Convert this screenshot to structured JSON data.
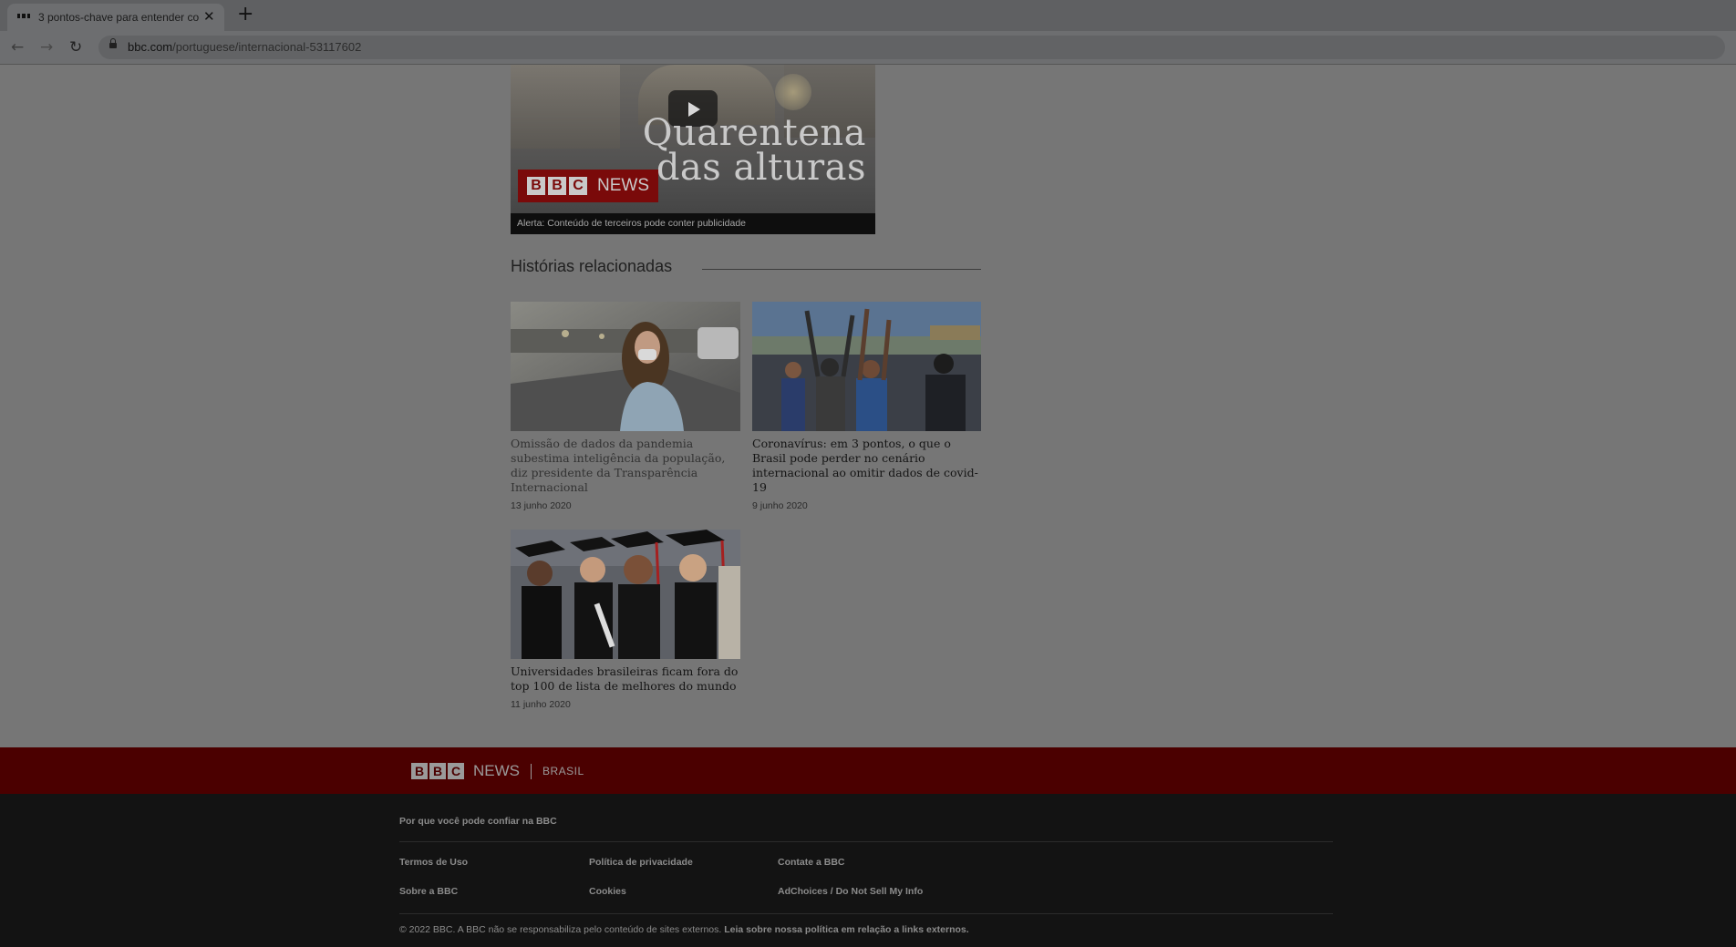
{
  "browser": {
    "tab_title": "3 pontos-chave para entender co",
    "url_host": "bbc.com",
    "url_path": "/portuguese/internacional-53117602"
  },
  "video": {
    "title_line1": "Quarentena",
    "title_line2": "das alturas",
    "logo_letters": [
      "B",
      "B",
      "C"
    ],
    "logo_word": "NEWS",
    "alert": "Alerta: Conteúdo de terceiros pode conter publicidade"
  },
  "related": {
    "heading": "Histórias relacionadas",
    "stories": [
      {
        "title": "Omissão de dados da pandemia subestima inteligência da população, diz presidente da Transparência Internacional",
        "date": "13 junho 2020"
      },
      {
        "title": "Coronavírus: em 3 pontos, o que o Brasil pode perder no cenário internacional ao omitir dados de covid-19",
        "date": "9 junho 2020"
      },
      {
        "title": "Universidades brasileiras ficam fora do top 100 de lista de melhores do mundo",
        "date": "11 junho 2020"
      }
    ]
  },
  "footer": {
    "logo_letters": [
      "B",
      "B",
      "C"
    ],
    "logo_word": "NEWS",
    "region": "BRASIL",
    "trust": "Por que você pode confiar na BBC",
    "links": [
      "Termos de Uso",
      "Política de privacidade",
      "Contate a BBC",
      "Sobre a BBC",
      "Cookies",
      "AdChoices / Do Not Sell My Info"
    ],
    "copyright": "© 2022 BBC. A BBC não se responsabiliza pelo conteúdo de sites externos.",
    "external_link": "Leia sobre nossa política em relação a links externos."
  },
  "colors": {
    "footer_red": "#4b0000",
    "bbc_red": "#7a0a0a",
    "footer_dark": "#131313"
  }
}
